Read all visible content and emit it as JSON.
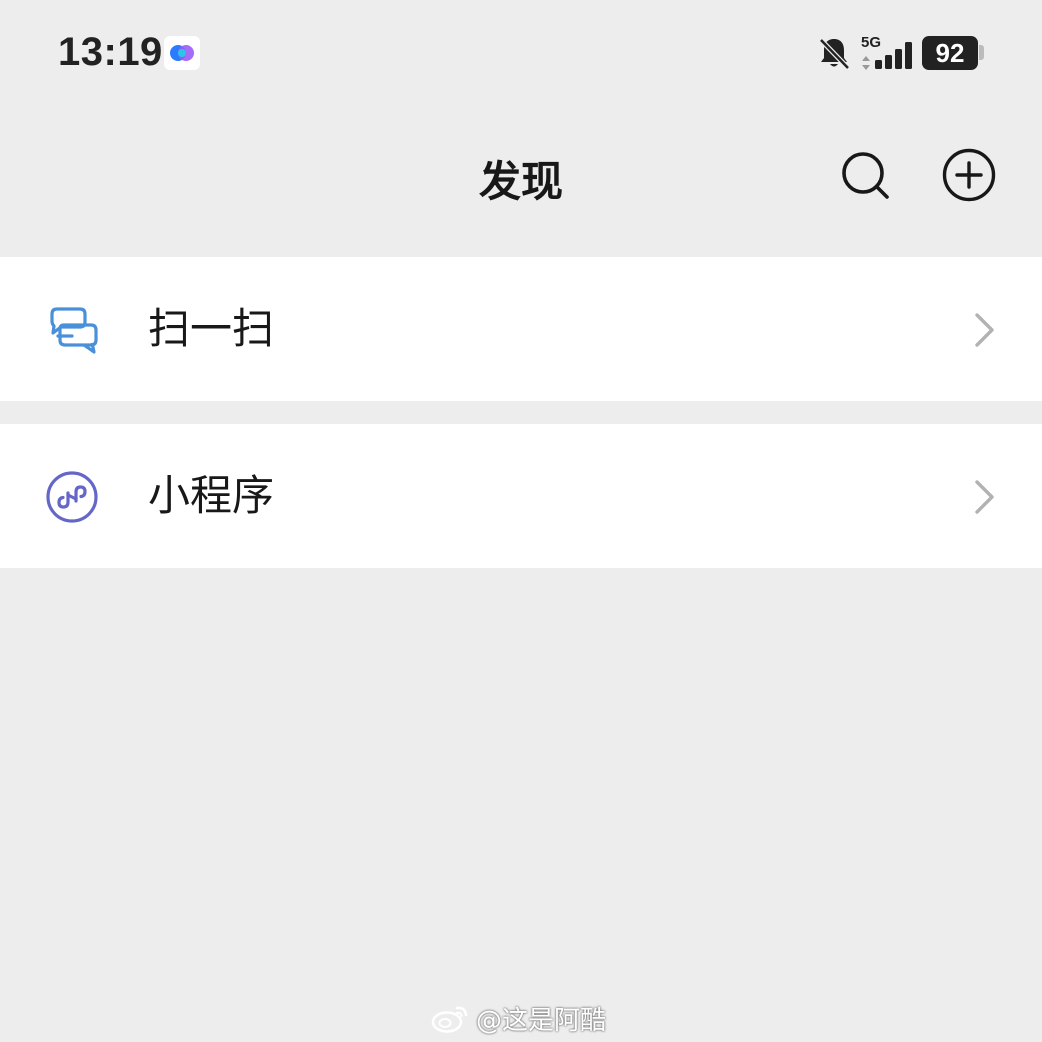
{
  "status_bar": {
    "time": "13:19",
    "network_type": "5G",
    "battery_level": "92",
    "icons": [
      "app-icon",
      "bell-off-icon",
      "signal-icon",
      "battery-icon"
    ]
  },
  "header": {
    "title": "发现",
    "actions": [
      {
        "name": "search-icon"
      },
      {
        "name": "add-circle-icon"
      }
    ]
  },
  "menu": {
    "items": [
      {
        "label": "扫一扫",
        "icon": "scan-icon",
        "icon_color": "#4a90d9"
      },
      {
        "label": "小程序",
        "icon": "mini-program-icon",
        "icon_color": "#6467c8"
      }
    ]
  },
  "colors": {
    "background": "#ededed",
    "cell_background": "#ffffff",
    "text": "#181818",
    "chevron": "#b2b2b2"
  },
  "watermark": {
    "text": "@这是阿酷"
  }
}
